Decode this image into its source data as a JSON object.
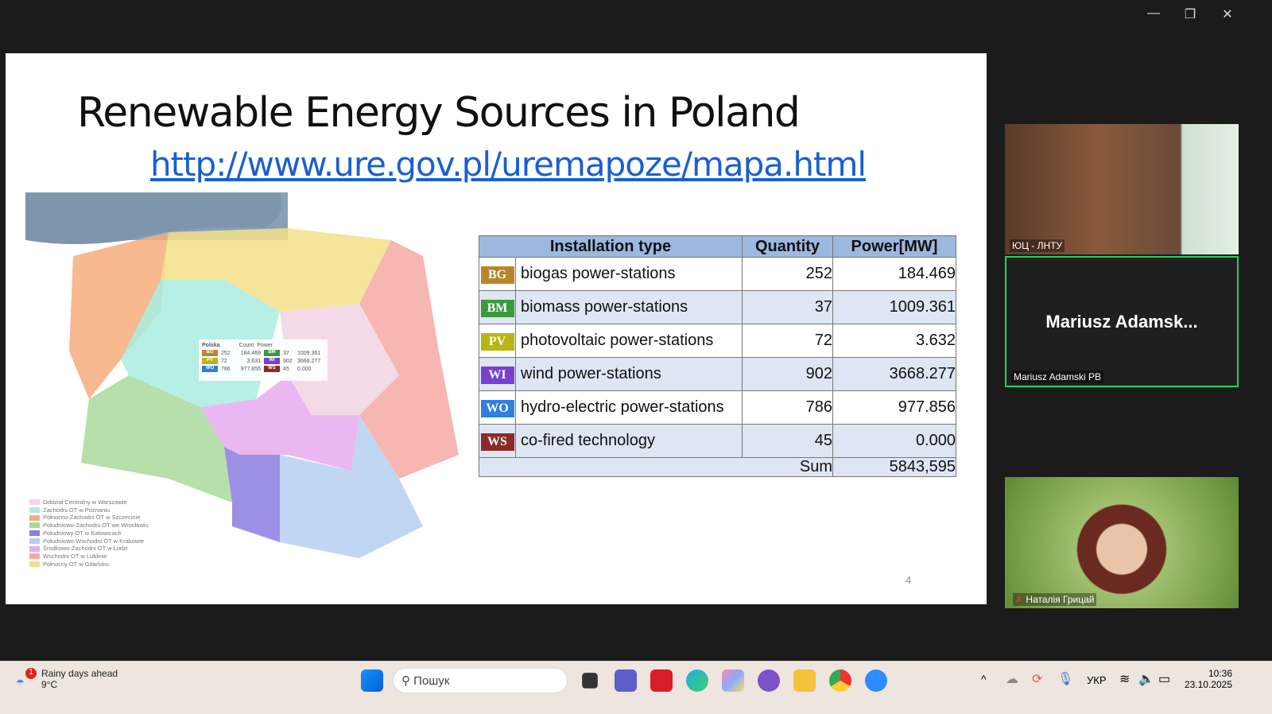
{
  "window": {
    "minimize": "—",
    "restore": "❐",
    "close": "✕"
  },
  "slide": {
    "title": "Renewable Energy Sources in Poland",
    "link": "http://www.ure.gov.pl/uremapoze/mapa.html",
    "page_number": "4",
    "table": {
      "headers": [
        "Installation type",
        "Quantity",
        "Power[MW]"
      ],
      "rows": [
        {
          "code": "BG",
          "color": "#b8862a",
          "type": "biogas power-stations",
          "quantity": "252",
          "power": "184.469"
        },
        {
          "code": "BM",
          "color": "#3c9a3c",
          "type": "biomass power-stations",
          "quantity": "37",
          "power": "1009.361"
        },
        {
          "code": "PV",
          "color": "#b9b515",
          "type": "photovoltaic power-stations",
          "quantity": "72",
          "power": "3.632"
        },
        {
          "code": "WI",
          "color": "#7b3fd0",
          "type": "wind power-stations",
          "quantity": "902",
          "power": "3668.277"
        },
        {
          "code": "WO",
          "color": "#2f7fe0",
          "type": "hydro-electric power-stations",
          "quantity": "786",
          "power": "977.856"
        },
        {
          "code": "WS",
          "color": "#8a2a2a",
          "type": "co-fired technology",
          "quantity": "45",
          "power": "0.000"
        }
      ],
      "sum_label": "Sum",
      "sum_value": "5843,595"
    },
    "map": {
      "mini_title": "Polska",
      "count": "Count",
      "power": "Power",
      "mini_rows": [
        [
          "BG",
          "252",
          "184.469",
          "BM",
          "37",
          "1009.361"
        ],
        [
          "PV",
          "72",
          "3.631",
          "WI",
          "902",
          "3668.277"
        ],
        [
          "WO",
          "786",
          "977.855",
          "WS",
          "45",
          "0.000"
        ]
      ],
      "legend": [
        {
          "label": "Oddział Centralny w Warszawie",
          "color": "#f3d6e4"
        },
        {
          "label": "Zachodni OT w Poznaniu",
          "color": "#a9ece0"
        },
        {
          "label": "Północno-Zachodni OT w Szczecinie",
          "color": "#f4ad7c"
        },
        {
          "label": "Południowo-Zachodni OT we Wrocławiu",
          "color": "#a9d99a"
        },
        {
          "label": "Południowy OT w Katowicach",
          "color": "#8a7ce0"
        },
        {
          "label": "Południowo-Wschodni OT w Krakowie",
          "color": "#b6cff0"
        },
        {
          "label": "Środkowo-Zachodni OT w Łodzi",
          "color": "#e8aaf0"
        },
        {
          "label": "Wschodni OT w Lublinie",
          "color": "#f4a9a4"
        },
        {
          "label": "Północny OT w Gdańsku",
          "color": "#f2e08a"
        }
      ]
    }
  },
  "participants": [
    {
      "name": "ЮЦ - ЛНТУ"
    },
    {
      "display": "Mariusz  Adamsk...",
      "name": "Mariusz Adamski PB"
    },
    {
      "name": "Наталія Грицай"
    }
  ],
  "taskbar": {
    "weather_badge": "1",
    "weather_title": "Rainy days ahead",
    "weather_temp": "9°C",
    "search_placeholder": "Пошук",
    "language": "УКР",
    "time": "10:36",
    "date": "23.10.2025"
  }
}
